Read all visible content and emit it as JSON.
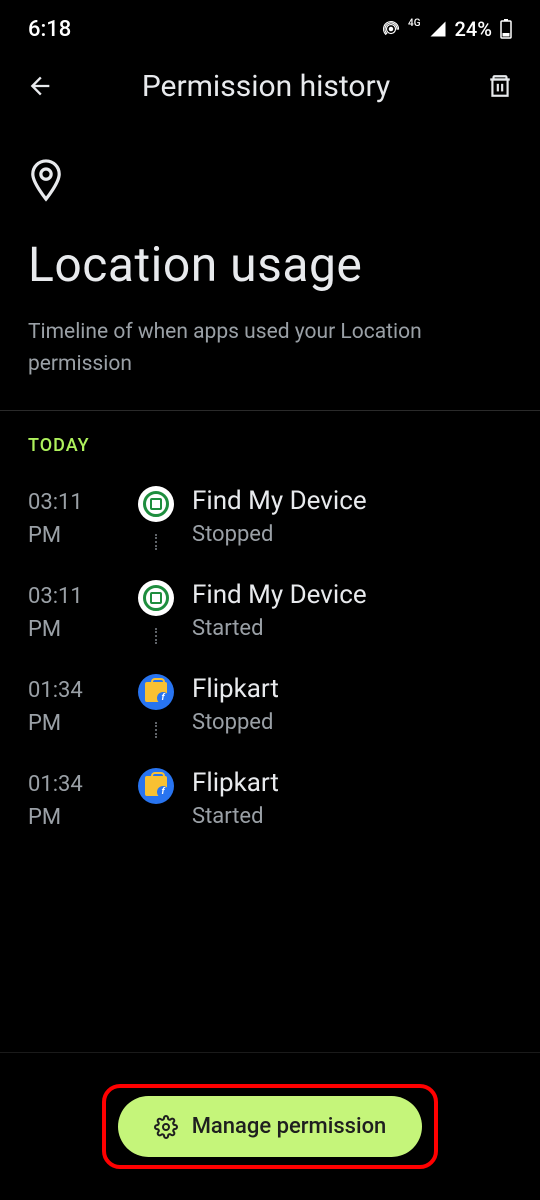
{
  "status_bar": {
    "time": "6:18",
    "network": "4G",
    "battery_percent": "24%"
  },
  "app_bar": {
    "title": "Permission history"
  },
  "header": {
    "title": "Location usage",
    "subtitle": "Timeline of when apps used your Location permission"
  },
  "section_label": "TODAY",
  "timeline": [
    {
      "time_line1": "03:11",
      "time_line2": "PM",
      "app_name": "Find My Device",
      "status": "Stopped",
      "icon_type": "fmd"
    },
    {
      "time_line1": "03:11",
      "time_line2": "PM",
      "app_name": "Find My Device",
      "status": "Started",
      "icon_type": "fmd"
    },
    {
      "time_line1": "01:34",
      "time_line2": "PM",
      "app_name": "Flipkart",
      "status": "Stopped",
      "icon_type": "flipkart"
    },
    {
      "time_line1": "01:34",
      "time_line2": "PM",
      "app_name": "Flipkart",
      "status": "Started",
      "icon_type": "flipkart"
    }
  ],
  "button": {
    "label": "Manage permission"
  },
  "colors": {
    "accent": "#aef15c",
    "button_bg": "#c5f57a"
  }
}
